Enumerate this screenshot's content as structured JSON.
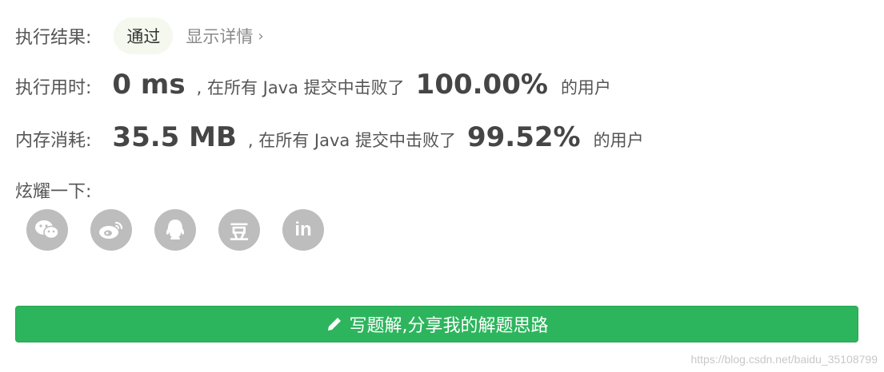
{
  "result": {
    "label": "执行结果:",
    "status": "通过",
    "details_link": "显示详情",
    "details_chevron": "chevron-right-icon"
  },
  "runtime": {
    "label": "执行用时:",
    "value": "0 ms",
    "middle_text": ", 在所有 Java 提交中击败了",
    "percent": "100.00%",
    "suffix": "的用户"
  },
  "memory": {
    "label": "内存消耗:",
    "value": "35.5 MB",
    "middle_text": ", 在所有 Java 提交中击败了",
    "percent": "99.52%",
    "suffix": "的用户"
  },
  "share": {
    "label": "炫耀一下:",
    "icons": [
      "wechat-icon",
      "weibo-icon",
      "qq-icon",
      "douban-icon",
      "linkedin-icon"
    ],
    "douban_glyph": "豆",
    "linkedin_glyph": "in"
  },
  "cta": {
    "label": "写题解,分享我的解题思路",
    "icon": "pencil-icon"
  },
  "watermark": "https://blog.csdn.net/baidu_35108799",
  "colors": {
    "accent_green": "#2db55d",
    "badge_bg": "#f5f8ee",
    "icon_gray": "#bdbdbd"
  }
}
